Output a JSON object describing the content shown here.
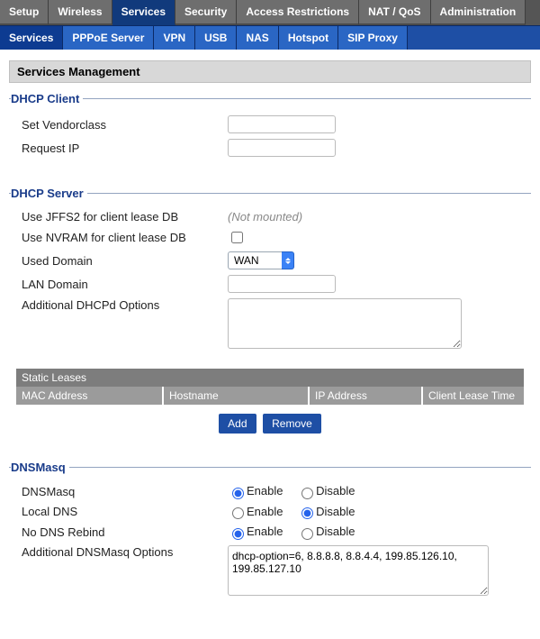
{
  "topnav": {
    "tabs": [
      "Setup",
      "Wireless",
      "Services",
      "Security",
      "Access Restrictions",
      "NAT / QoS",
      "Administration"
    ],
    "active": "Services"
  },
  "subnav": {
    "tabs": [
      "Services",
      "PPPoE Server",
      "VPN",
      "USB",
      "NAS",
      "Hotspot",
      "SIP Proxy"
    ],
    "active": "Services"
  },
  "panel_title": "Services Management",
  "dhcp_client": {
    "legend": "DHCP Client",
    "vendorclass_label": "Set Vendorclass",
    "vendorclass_value": "",
    "requestip_label": "Request IP",
    "requestip_value": ""
  },
  "dhcp_server": {
    "legend": "DHCP Server",
    "jffs2_label": "Use JFFS2 for client lease DB",
    "jffs2_note": "(Not mounted)",
    "nvram_label": "Use NVRAM for client lease DB",
    "nvram_checked": false,
    "domain_label": "Used Domain",
    "domain_value": "WAN",
    "landomain_label": "LAN Domain",
    "landomain_value": "",
    "options_label": "Additional DHCPd Options",
    "options_value": "",
    "static_leases_title": "Static Leases",
    "cols": {
      "mac": "MAC Address",
      "host": "Hostname",
      "ip": "IP Address",
      "lease": "Client Lease Time"
    },
    "add_btn": "Add",
    "remove_btn": "Remove"
  },
  "dnsmasq": {
    "legend": "DNSMasq",
    "enable_text": "Enable",
    "disable_text": "Disable",
    "dnsmasq_label": "DNSMasq",
    "dnsmasq_value": "enable",
    "localdns_label": "Local DNS",
    "localdns_value": "disable",
    "norebind_label": "No DNS Rebind",
    "norebind_value": "enable",
    "options_label": "Additional DNSMasq Options",
    "options_value": "dhcp-option=6, 8.8.8.8, 8.8.4.4, 199.85.126.10, 199.85.127.10"
  }
}
